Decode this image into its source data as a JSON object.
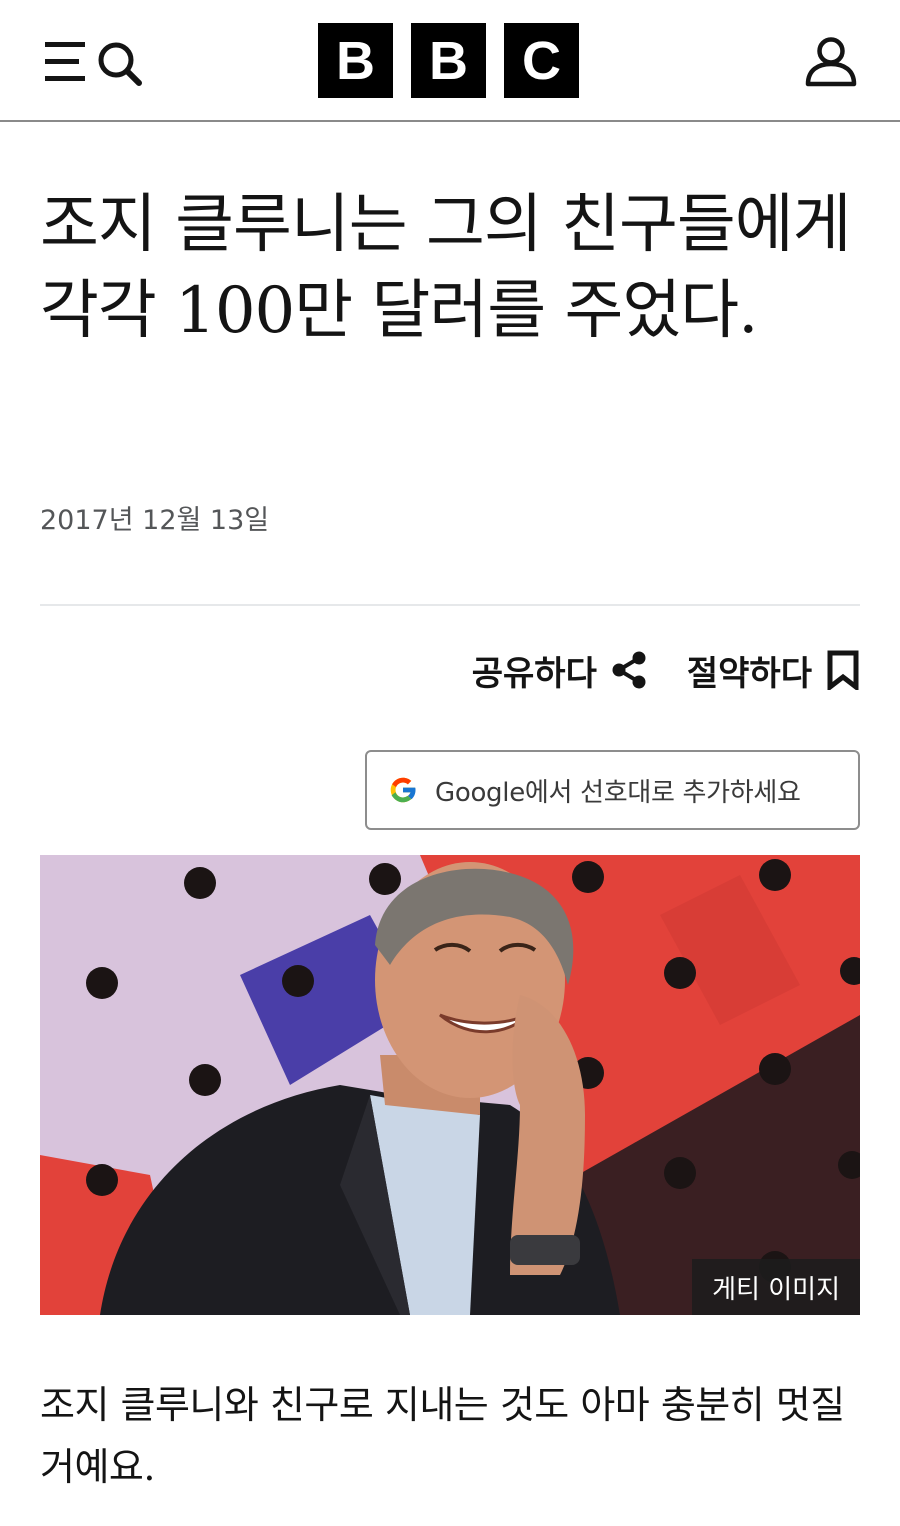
{
  "header": {
    "logo_letters": [
      "B",
      "B",
      "C"
    ],
    "menu_icon": "menu-icon",
    "search_icon": "search-icon",
    "account_icon": "account-icon"
  },
  "article": {
    "headline": "조지 클루니는 그의 친구들에게 각각 100만 달러를 주었다.",
    "date": "2017년 12월 13일",
    "actions": {
      "share_label": "공유하다",
      "save_label": "절약하다"
    },
    "google_button_label": "Google에서 선호대로 추가하세요",
    "image": {
      "credit": "게티 이미지"
    },
    "body_paragraph": "조지 클루니와 친구로 지내는 것도 아마 충분히 멋질 거예요."
  },
  "colors": {
    "brand_black": "#000000",
    "divider": "#e6e8ea",
    "muted_text": "#545658"
  }
}
